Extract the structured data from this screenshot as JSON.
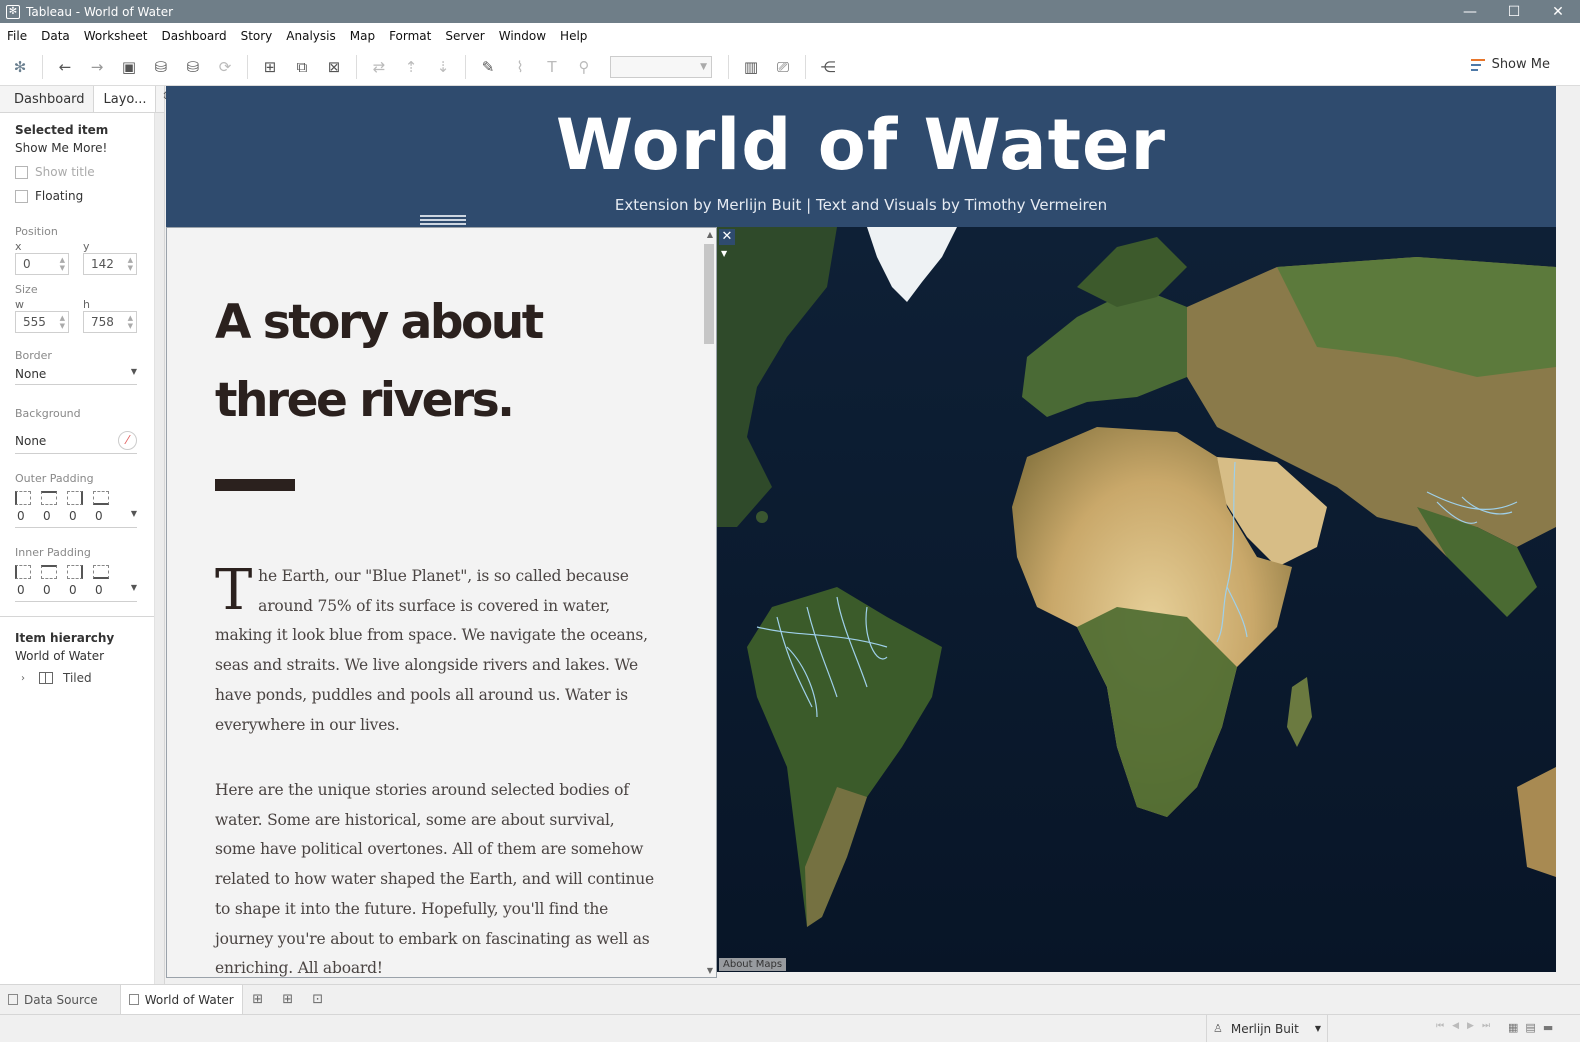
{
  "window": {
    "title": "Tableau - World of Water",
    "minimize": "—",
    "maximize": "☐",
    "close": "✕"
  },
  "menu": [
    "File",
    "Data",
    "Worksheet",
    "Dashboard",
    "Story",
    "Analysis",
    "Map",
    "Format",
    "Server",
    "Window",
    "Help"
  ],
  "toolbar": {
    "show_me": "Show Me"
  },
  "left_panel": {
    "tabs": [
      "Dashboard",
      "Layo..."
    ],
    "selected_item_heading": "Selected item",
    "selected_item_value": "Show Me More!",
    "show_title": "Show title",
    "floating": "Floating",
    "position_label": "Position",
    "x_label": "x",
    "x_value": "0",
    "y_label": "y",
    "y_value": "142",
    "size_label": "Size",
    "w_label": "w",
    "w_value": "555",
    "h_label": "h",
    "h_value": "758",
    "border_label": "Border",
    "border_value": "None",
    "background_label": "Background",
    "background_value": "None",
    "outer_padding_label": "Outer Padding",
    "outer_padding": [
      "0",
      "0",
      "0",
      "0"
    ],
    "inner_padding_label": "Inner Padding",
    "inner_padding": [
      "0",
      "0",
      "0",
      "0"
    ],
    "hierarchy_heading": "Item hierarchy",
    "hierarchy_root": "World of Water",
    "hierarchy_child": "Tiled"
  },
  "dashboard": {
    "title": "World of Water",
    "subtitle": "Extension by Merlijn Buit | Text and Visuals by Timothy Vermeiren",
    "story_heading": "A story about three rivers.",
    "dropcap": "T",
    "paragraph1": "he Earth, our \"Blue Planet\", is so called because around 75% of its surface is covered in water, making it look blue from space. We navigate the oceans, seas and straits. We live alongside rivers and lakes. We have ponds, puddles and pools all around us. Water is everywhere in our lives.",
    "paragraph2": "Here are the unique stories around selected bodies of water. Some are historical, some are about survival, some have political overtones. All of them are somehow related to how water shaped the Earth, and will continue to shape it into the future. Hopefully, you'll find the journey you're about to embark on fascinating as well as enriching. All aboard!",
    "about_maps": "About Maps"
  },
  "bottom_tabs": {
    "data_source": "Data Source",
    "sheet": "World of Water"
  },
  "status": {
    "user": "Merlijn Buit"
  },
  "colors": {
    "header_bg": "#2f4b6e",
    "ocean": "#0b1a2e",
    "land": "#3e5a2a",
    "desert": "#cdb27a",
    "river": "#9fd0ea"
  }
}
